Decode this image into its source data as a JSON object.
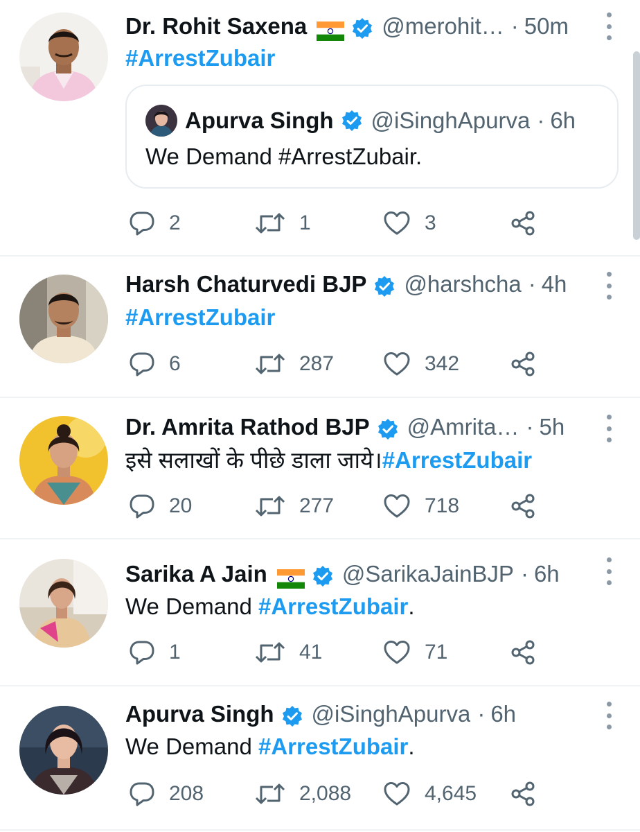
{
  "tweets": [
    {
      "name": "Dr. Rohit Saxena",
      "has_flag": true,
      "handle": "@merohit…",
      "separator": "·",
      "time": "50m",
      "text_pre": "",
      "hashtag": "#ArrestZubair",
      "text_post": "",
      "quote": {
        "name": "Apurva Singh",
        "handle": "@iSinghApurva",
        "separator": "·",
        "time": "6h",
        "text": "We Demand #ArrestZubair."
      },
      "replies": "2",
      "retweets": "1",
      "likes": "3"
    },
    {
      "name": "Harsh Chaturvedi BJP",
      "has_flag": false,
      "handle": "@harshcha",
      "separator": "·",
      "time": "4h",
      "text_pre": "",
      "hashtag": "#ArrestZubair",
      "text_post": "",
      "replies": "6",
      "retweets": "287",
      "likes": "342"
    },
    {
      "name": "Dr. Amrita Rathod BJP",
      "has_flag": false,
      "handle": "@Amrita…",
      "separator": "·",
      "time": "5h",
      "text_pre": "इसे सलाखों के पीछे डाला जाये।",
      "hashtag": "#ArrestZubair",
      "text_post": "",
      "replies": "20",
      "retweets": "277",
      "likes": "718"
    },
    {
      "name": "Sarika A Jain",
      "has_flag": true,
      "handle": "@SarikaJainBJP",
      "separator": "·",
      "time": "6h",
      "text_pre": "We Demand ",
      "hashtag": "#ArrestZubair",
      "text_post": ".",
      "replies": "1",
      "retweets": "41",
      "likes": "71"
    },
    {
      "name": "Apurva Singh",
      "has_flag": false,
      "handle": "@iSinghApurva",
      "separator": "·",
      "time": "6h",
      "text_pre": "We Demand ",
      "hashtag": "#ArrestZubair",
      "text_post": ".",
      "replies": "208",
      "retweets": "2,088",
      "likes": "4,645"
    }
  ],
  "colors": {
    "accent": "#1d9bf0",
    "secondary_text": "#536471",
    "divider": "#eff3f4",
    "verified_badge": "#1d9bf0"
  },
  "icons": {
    "reply": "reply-icon",
    "retweet": "retweet-icon",
    "like": "heart-icon",
    "share": "share-icon",
    "verified": "verified-badge-icon",
    "flag": "india-flag-icon",
    "more": "more-vertical-icon"
  }
}
